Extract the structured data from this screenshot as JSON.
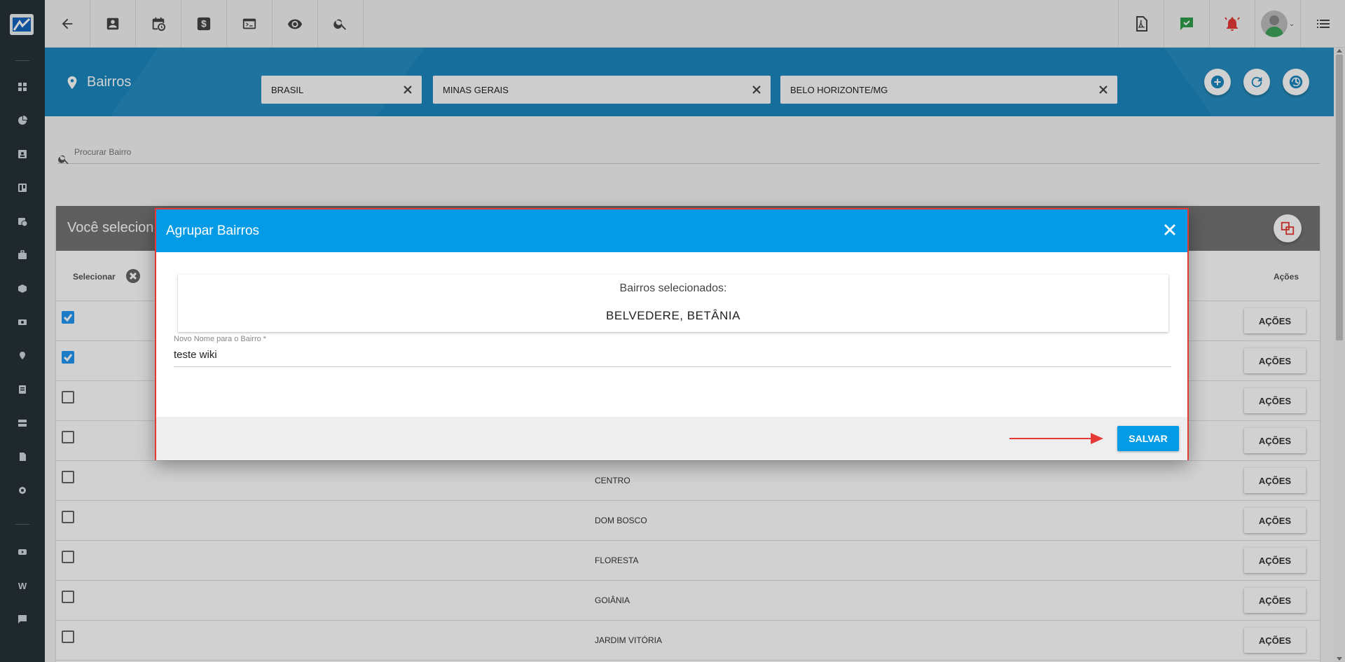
{
  "sidebar": {
    "logo_icon": "app-logo",
    "items": [
      {
        "icon": "dashboard-icon"
      },
      {
        "icon": "pie-chart-icon"
      },
      {
        "icon": "contact-card-icon"
      },
      {
        "icon": "board-icon"
      },
      {
        "icon": "calendar-clock-icon"
      },
      {
        "icon": "briefcase-icon"
      },
      {
        "icon": "cube-icon"
      },
      {
        "icon": "money-icon"
      },
      {
        "icon": "map-pin-icon"
      },
      {
        "icon": "list-icon"
      },
      {
        "icon": "server-icon"
      },
      {
        "icon": "document-icon"
      },
      {
        "icon": "gear-icon"
      },
      {
        "icon": "youtube-icon"
      },
      {
        "icon": "wiki-icon",
        "glyph": "W"
      },
      {
        "icon": "chat-icon"
      }
    ]
  },
  "topbar": {
    "left_buttons": [
      "back-arrow-icon",
      "contact-card-icon",
      "calendar-clock-icon",
      "dollar-icon",
      "terminal-icon",
      "eye-icon",
      "search-icon"
    ],
    "right_buttons": [
      "pdf-icon",
      "message-check-icon",
      "alarm-bell-icon",
      "user-avatar",
      "list-menu-icon"
    ]
  },
  "header": {
    "title": "Bairros",
    "filters": [
      {
        "label": "BRASIL"
      },
      {
        "label": "MINAS GERAIS"
      },
      {
        "label": "BELO HORIZONTE/MG"
      }
    ]
  },
  "search": {
    "placeholder": "Procurar Bairro"
  },
  "table": {
    "selection_title": "Você selecion",
    "col_select": "Selecionar",
    "col_actions": "Ações",
    "rows": [
      {
        "name": "",
        "checked": true,
        "action": "AÇÕES"
      },
      {
        "name": "",
        "checked": true,
        "action": "AÇÕES"
      },
      {
        "name": "",
        "checked": false,
        "action": "AÇÕES"
      },
      {
        "name": "",
        "checked": false,
        "action": "AÇÕES"
      },
      {
        "name": "CENTRO",
        "checked": false,
        "action": "AÇÕES"
      },
      {
        "name": "DOM BOSCO",
        "checked": false,
        "action": "AÇÕES"
      },
      {
        "name": "FLORESTA",
        "checked": false,
        "action": "AÇÕES"
      },
      {
        "name": "GOIÂNIA",
        "checked": false,
        "action": "AÇÕES"
      },
      {
        "name": "JARDIM VITÓRIA",
        "checked": false,
        "action": "AÇÕES"
      }
    ]
  },
  "modal": {
    "title": "Agrupar Bairros",
    "selected_label": "Bairros selecionados:",
    "selected_names": "BELVEDERE,  BETÂNIA",
    "field_label": "Novo Nome para o Bairro *",
    "field_value": "teste wiki",
    "save_label": "SALVAR",
    "annotation_color": "#e53935"
  },
  "colors": {
    "accent": "#1a87bf",
    "modal_header": "#039be5",
    "sidebar": "#263238"
  }
}
